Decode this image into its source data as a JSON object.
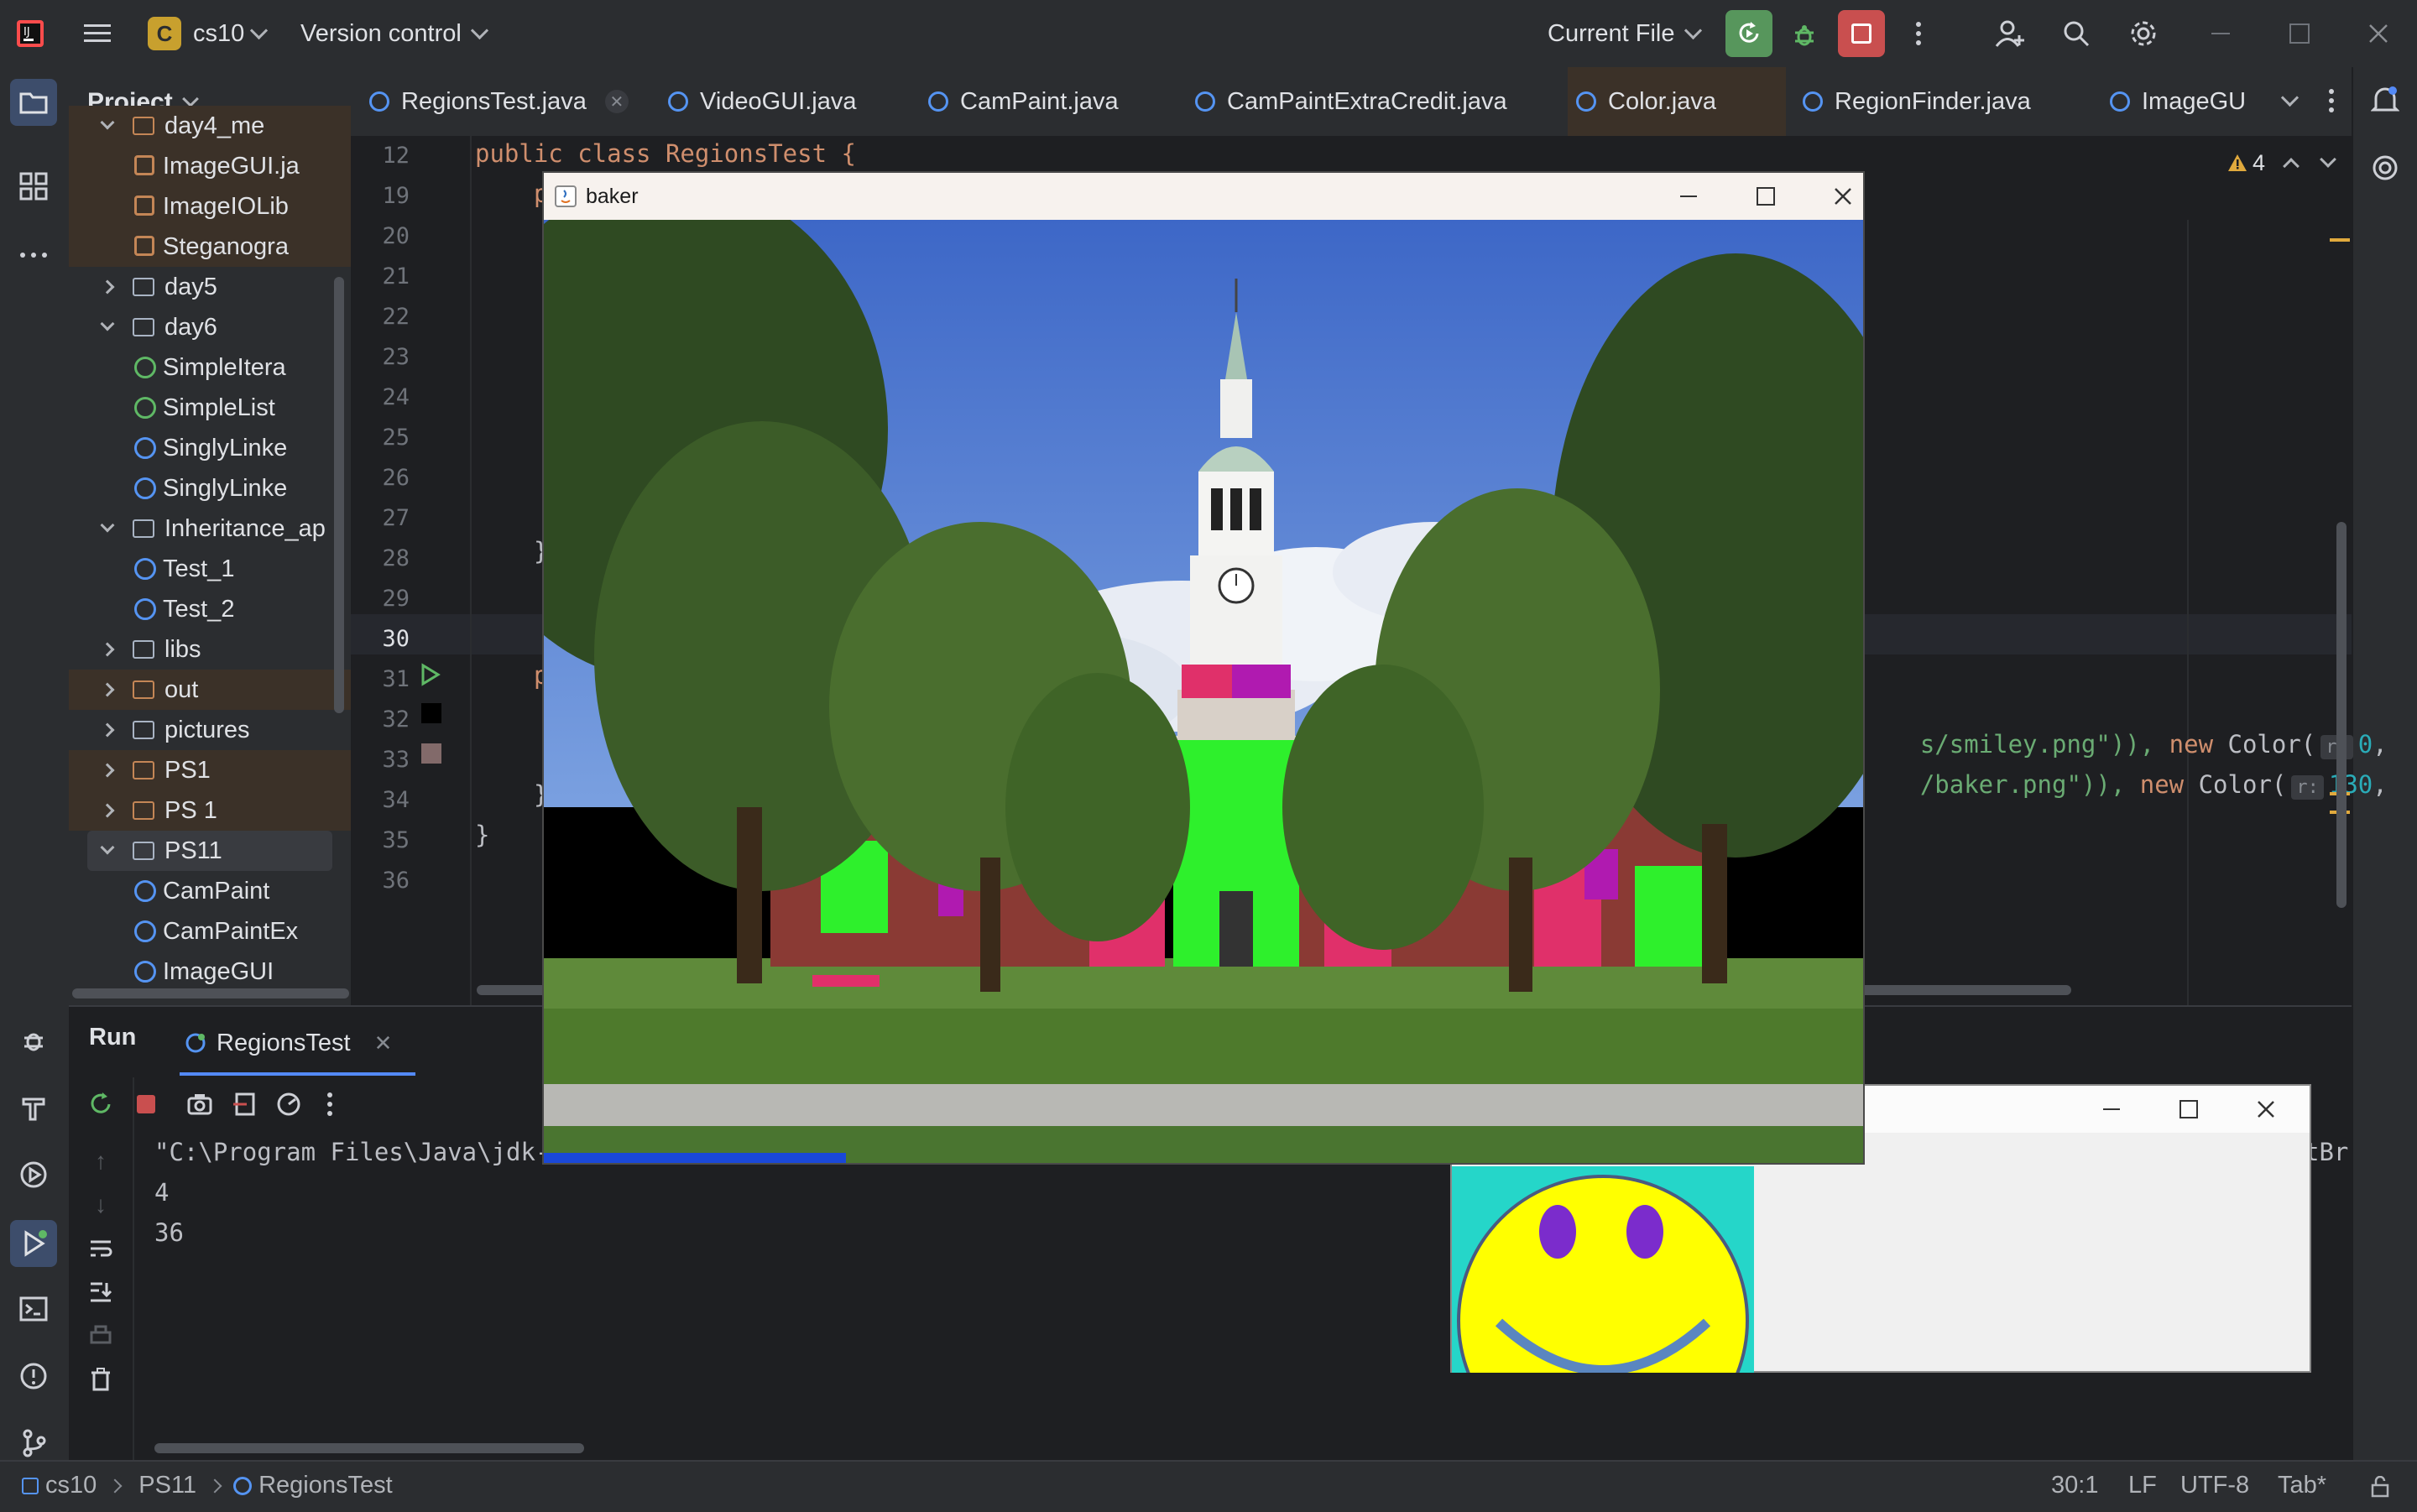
{
  "titlebar": {
    "project_badge": "C",
    "project_name": "cs10",
    "vcs_label": "Version control",
    "run_config": "Current File"
  },
  "project_panel": {
    "header": "Project",
    "items": [
      {
        "label": "day4_me",
        "kind": "folder-orange",
        "expanded": true
      },
      {
        "label": "ImageGUI.ja",
        "kind": "java-file"
      },
      {
        "label": "ImageIOLib",
        "kind": "java-file"
      },
      {
        "label": "Steganogra",
        "kind": "java-file"
      },
      {
        "label": "day5",
        "kind": "folder"
      },
      {
        "label": "day6",
        "kind": "folder",
        "expanded": true
      },
      {
        "label": "SimpleItera",
        "kind": "interface"
      },
      {
        "label": "SimpleList",
        "kind": "interface"
      },
      {
        "label": "SinglyLinke",
        "kind": "class"
      },
      {
        "label": "SinglyLinke",
        "kind": "class-run"
      },
      {
        "label": "Inheritance_ap",
        "kind": "folder",
        "expanded": true
      },
      {
        "label": "Test_1",
        "kind": "class-run"
      },
      {
        "label": "Test_2",
        "kind": "class-run"
      },
      {
        "label": "libs",
        "kind": "folder"
      },
      {
        "label": "out",
        "kind": "folder-orange"
      },
      {
        "label": "pictures",
        "kind": "folder"
      },
      {
        "label": "PS1",
        "kind": "folder-orange"
      },
      {
        "label": "PS 1",
        "kind": "folder-orange"
      },
      {
        "label": "PS11",
        "kind": "folder",
        "expanded": true
      },
      {
        "label": "CamPaint",
        "kind": "class-run"
      },
      {
        "label": "CamPaintEx",
        "kind": "class-run"
      },
      {
        "label": "ImageGUI",
        "kind": "class"
      }
    ]
  },
  "tabs": [
    {
      "label": "RegionsTest.java",
      "active": true
    },
    {
      "label": "VideoGUI.java"
    },
    {
      "label": "CamPaint.java"
    },
    {
      "label": "CamPaintExtraCredit.java"
    },
    {
      "label": "Color.java"
    },
    {
      "label": "RegionFinder.java"
    },
    {
      "label": "ImageGU"
    }
  ],
  "editor": {
    "warning_count": "4",
    "line_numbers": [
      "12",
      "19",
      "20",
      "21",
      "22",
      "23",
      "24",
      "25",
      "26",
      "27",
      "28",
      "29",
      "30",
      "31",
      "32",
      "33",
      "34",
      "35",
      "36"
    ],
    "code_line_12": "public class RegionsTest {",
    "frag_19": "p",
    "frag_28": "}",
    "frag_31": "p",
    "frag_34": "}",
    "frag_35": "}",
    "frag_32_path": "s/smiley.png\")), ",
    "frag_32_new": "new",
    "frag_32_color": " Color(",
    "frag_32_hint": "r:",
    "frag_32_val": "0",
    "frag_32_tail": ", ",
    "frag_33_path": "/baker.png\")), ",
    "frag_33_new": "new",
    "frag_33_color": " Color(",
    "frag_33_hint": "r:",
    "frag_33_val": "130",
    "frag_33_tail": ", "
  },
  "run": {
    "tool_label": "Run",
    "tab_label": "RegionsTest",
    "console": [
      "\"C:\\Program Files\\Java\\jdk-",
      "4",
      "36"
    ],
    "console_tail": "tBr"
  },
  "baker_window": {
    "title": "baker",
    "sky_color": "#4a76d0",
    "grass_color": "#4e7a2c",
    "highlight_green": "#2ef02c",
    "highlight_pink": "#e0306a",
    "highlight_magenta": "#b01ab0"
  },
  "smiley_window": {
    "face_color": "#ffff00",
    "background_color": "#25d6c9",
    "eye_color": "#7b2ccc"
  },
  "statusbar": {
    "crumbs": [
      "cs10",
      "PS11",
      "RegionsTest"
    ],
    "position": "30:1",
    "line_sep": "LF",
    "encoding": "UTF-8",
    "indent": "Tab*"
  }
}
